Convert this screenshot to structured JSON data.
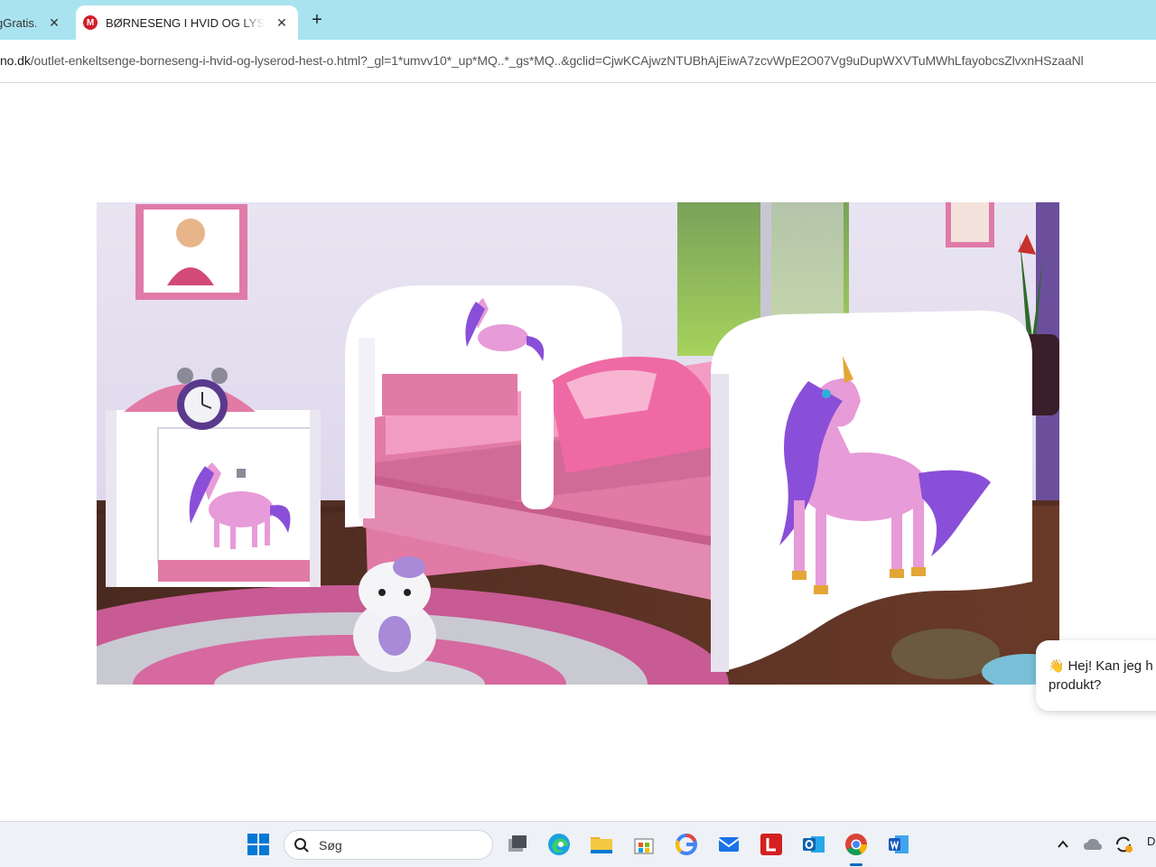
{
  "browser": {
    "tabs": [
      {
        "title": "gGratis...",
        "active": false
      },
      {
        "title": "BØRNESENG I HVID OG LYSERØD",
        "favicon_letter": "M",
        "active": true
      }
    ],
    "close_glyph": "✕",
    "new_tab_glyph": "+",
    "url": {
      "host": "no.dk",
      "path": "/outlet-enkeltsenge-borneseng-i-hvid-og-lyserod-hest-o.html?_gl=1*umvv10*_up*MQ..*_gs*MQ..&gclid=CjwKCAjwzNTUBhAjEiwA7zcvWpE2O07Vg9uDupWXVTuMWhLfayobcsZlvxnHSzaaNl"
    }
  },
  "chat": {
    "wave_emoji": "👋",
    "line1": "Hej! Kan jeg h",
    "line2": "produkt?"
  },
  "taskbar": {
    "search_placeholder": "Søg",
    "tray_label": "D"
  },
  "colors": {
    "tab_strip": "#a9e3f0",
    "favicon": "#d0202a",
    "bed_pink": "#e27aa6",
    "unicorn_mane": "#8a4fd8"
  }
}
